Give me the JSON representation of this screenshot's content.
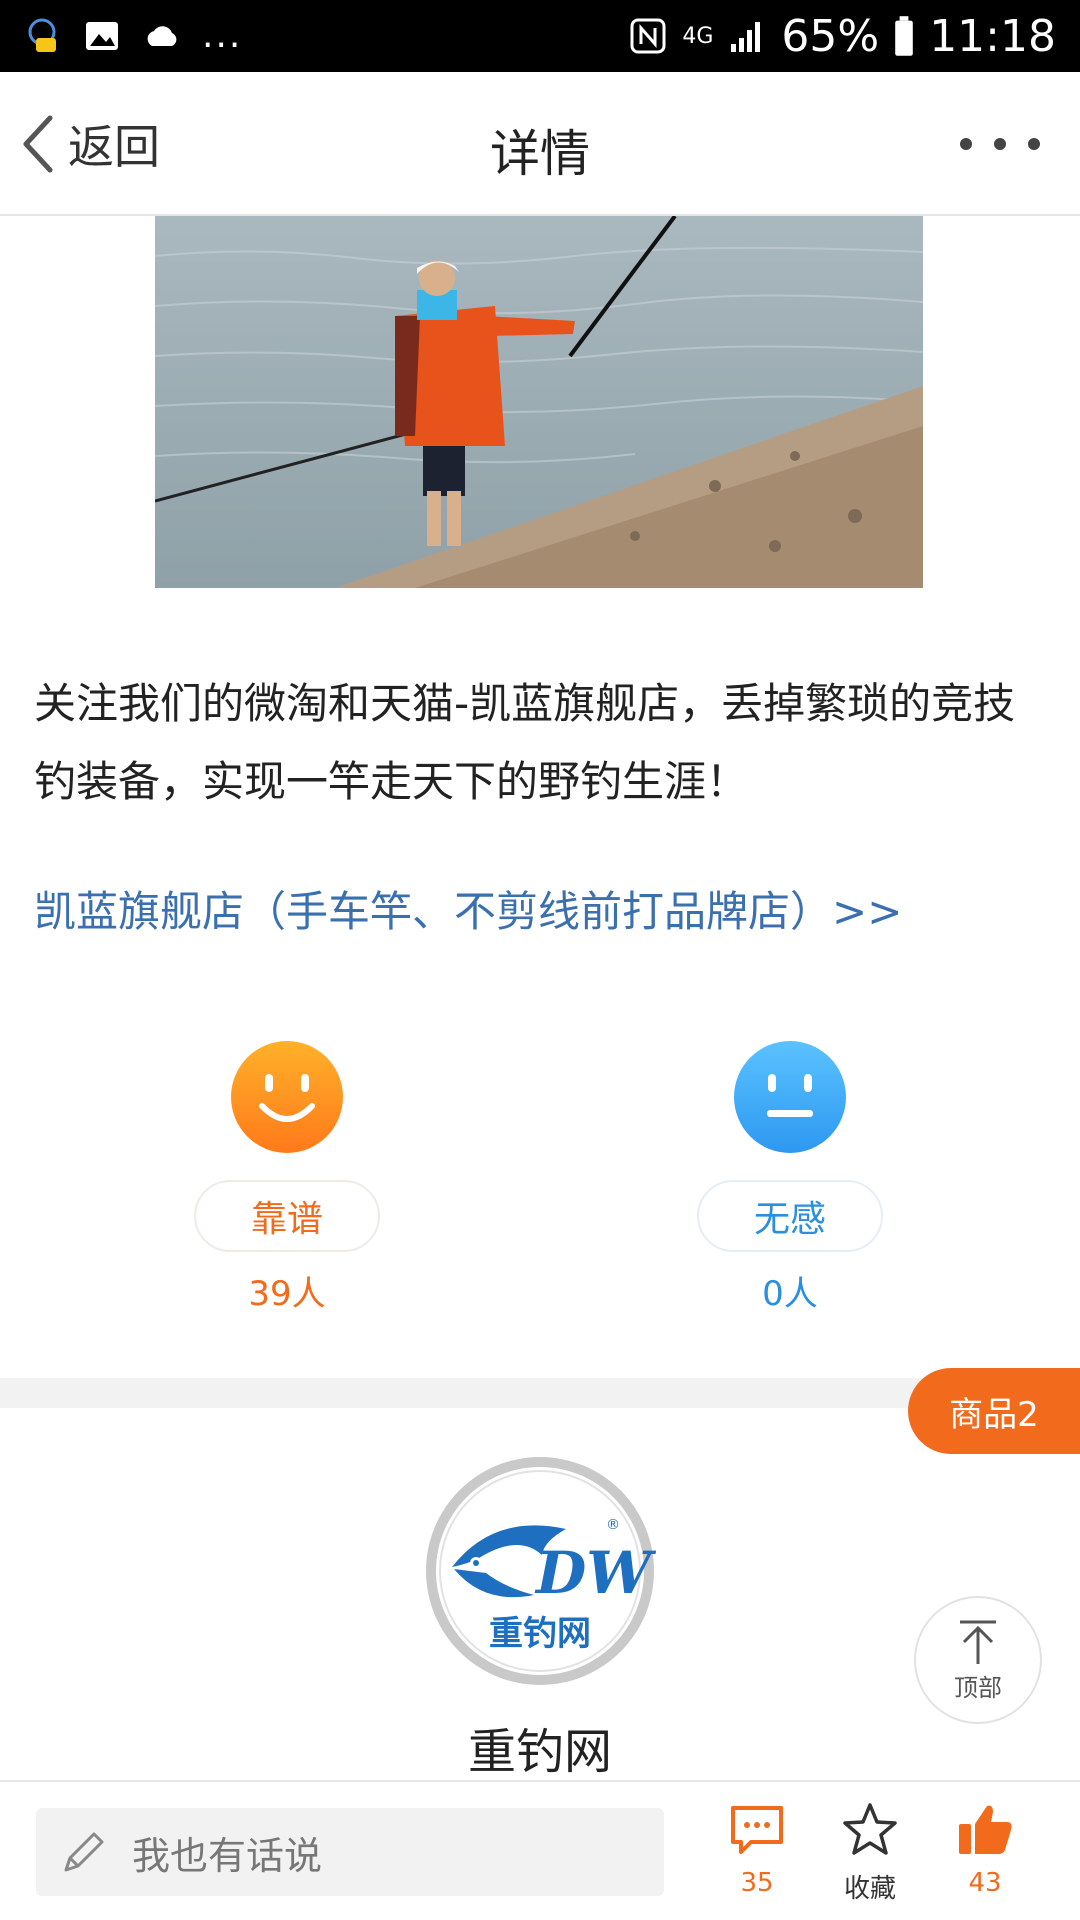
{
  "status_bar": {
    "network": "4G",
    "battery": "65%",
    "time": "11:18",
    "overflow": "..."
  },
  "nav": {
    "back_label": "返回",
    "title": "详情"
  },
  "article": {
    "paragraph": "关注我们的微淘和天猫-凯蓝旗舰店，丢掉繁琐的竞技钓装备，实现一竿走天下的野钓生涯！",
    "shop_link": "凯蓝旗舰店（手车竿、不剪线前打品牌店）>>"
  },
  "ratings": {
    "reliable": {
      "label": "靠谱",
      "count": "39人"
    },
    "neutral": {
      "label": "无感",
      "count": "0人"
    }
  },
  "goods_tab": "商品2",
  "brand": {
    "name": "重钓网",
    "logo_text": "重钓网",
    "logo_mark": "DW"
  },
  "to_top_label": "顶部",
  "bottom_bar": {
    "comment_placeholder": "我也有话说",
    "comment_count": "35",
    "favorite_label": "收藏",
    "like_count": "43"
  },
  "colors": {
    "accent": "#f26b1d",
    "link": "#3a6fb0",
    "neutral_blue": "#2a8fe0"
  }
}
